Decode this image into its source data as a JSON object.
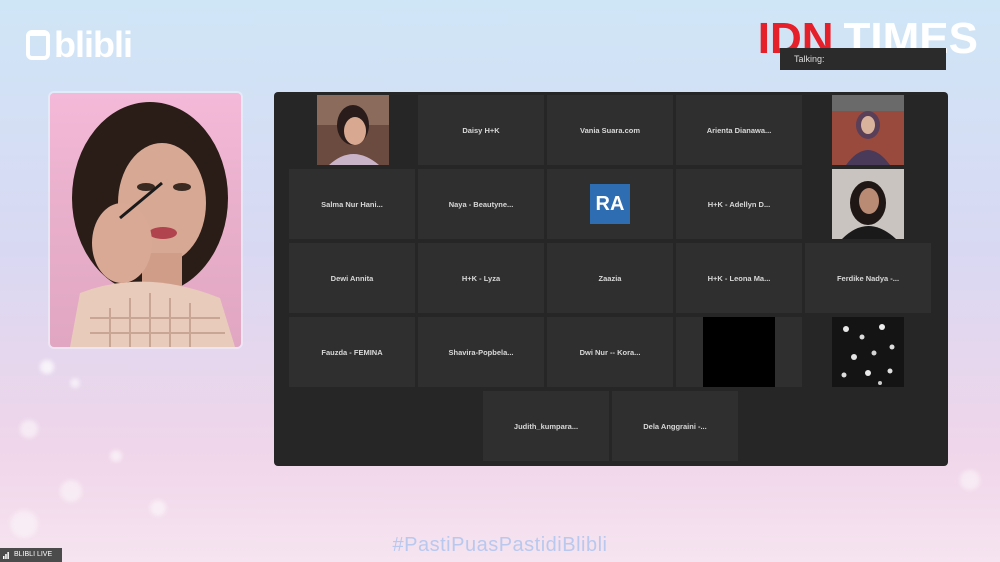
{
  "branding": {
    "logo_text": "blibli",
    "channel_red": "IDN",
    "channel_white": "TIMES",
    "hashtag": "#PastiPuasPastidiBlibli",
    "live_label": "BLIBLI LIVE"
  },
  "talking_label": "Talking:",
  "participants": [
    {
      "name": "",
      "type": "photo",
      "photo": "woman-smiling"
    },
    {
      "name": "Daisy H+K",
      "type": "name"
    },
    {
      "name": "Vania Suara.com",
      "type": "name"
    },
    {
      "name": "Arienta Dianawa...",
      "type": "name"
    },
    {
      "name": "",
      "type": "photo",
      "photo": "woman-hijab"
    },
    {
      "name": "Salma Nur Hani...",
      "type": "name"
    },
    {
      "name": "Naya - Beautyne...",
      "type": "name"
    },
    {
      "name": "",
      "type": "avatar",
      "initials": "RA"
    },
    {
      "name": "H+K - Adellyn D...",
      "type": "name"
    },
    {
      "name": "",
      "type": "photo",
      "photo": "woman-portrait"
    },
    {
      "name": "Dewi Annita",
      "type": "name"
    },
    {
      "name": "H+K - Lyza",
      "type": "name"
    },
    {
      "name": "Zaazia",
      "type": "name"
    },
    {
      "name": "H+K - Leona Ma...",
      "type": "name"
    },
    {
      "name": "Ferdike Nadya -...",
      "type": "name"
    },
    {
      "name": "Fauzda - FEMINA",
      "type": "name"
    },
    {
      "name": "Shavira-Popbela...",
      "type": "name"
    },
    {
      "name": "Dwi Nur -- Kora...",
      "type": "name"
    },
    {
      "name": "",
      "type": "black"
    },
    {
      "name": "",
      "type": "photo",
      "photo": "flowers"
    },
    {
      "name": "Judith_kumpara...",
      "type": "name"
    },
    {
      "name": "Dela Anggraini -...",
      "type": "name"
    }
  ]
}
